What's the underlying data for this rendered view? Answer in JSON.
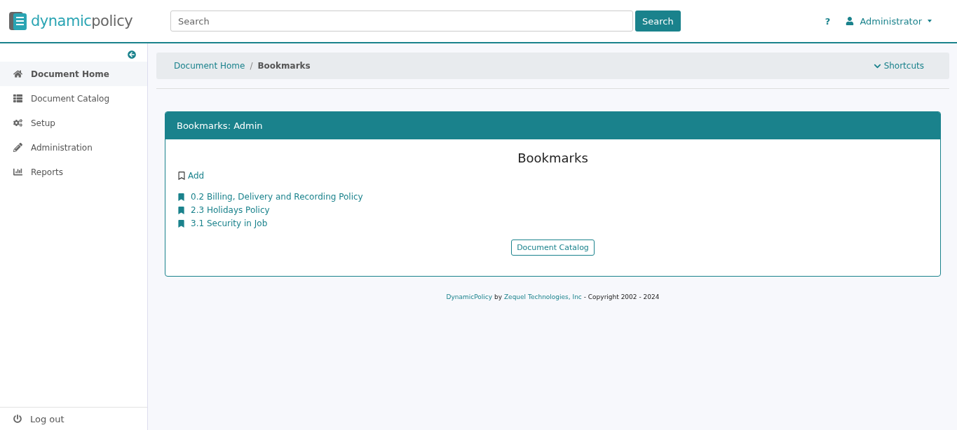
{
  "header": {
    "logo": {
      "part_1": "dynamic",
      "part_2": "policy"
    },
    "search": {
      "placeholder": "Search",
      "button": "Search"
    },
    "help": "?",
    "user": "Administrator"
  },
  "sidebar": {
    "items": [
      {
        "label": "Document Home",
        "selected": true
      },
      {
        "label": "Document Catalog",
        "selected": false
      },
      {
        "label": "Setup",
        "selected": false
      },
      {
        "label": "Administration",
        "selected": false
      },
      {
        "label": "Reports",
        "selected": false
      }
    ],
    "logout": "Log out"
  },
  "breadcrumb": {
    "items": [
      {
        "label": "Document Home",
        "current": false
      },
      {
        "label": "Bookmarks",
        "current": true
      }
    ],
    "separator": "/",
    "shortcuts": "Shortcuts"
  },
  "panel": {
    "title": "Bookmarks: Admin",
    "heading": "Bookmarks",
    "add": "Add",
    "bookmarks": [
      "0.2 Billing, Delivery and Recording Policy",
      "2.3 Holidays Policy",
      "3.1 Security in Job"
    ],
    "button": "Document Catalog"
  },
  "footer": {
    "link_1": "DynamicPolicy",
    "text_1": "by",
    "link_2": "Zequel Technologies, Inc",
    "text_2": "- Copyright 2002 - 2024"
  }
}
